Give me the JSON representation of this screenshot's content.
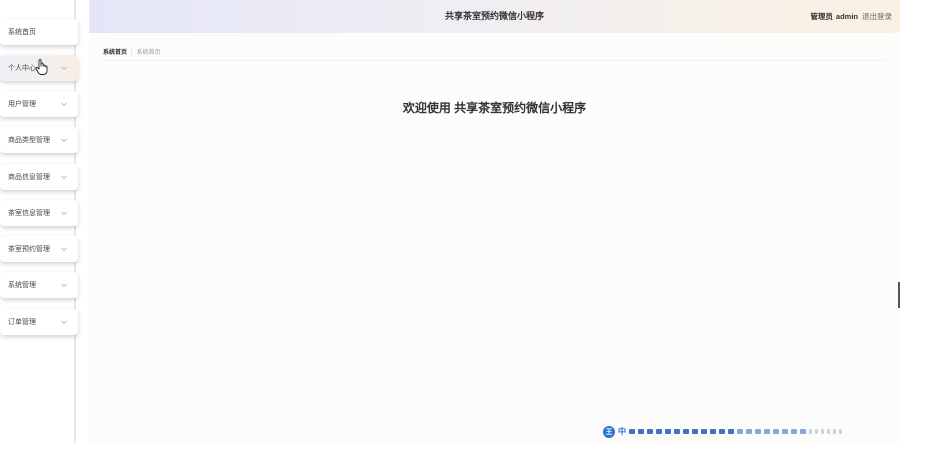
{
  "sidebar": {
    "items": [
      {
        "label": "系统首页",
        "has_chevron": false,
        "active": false
      },
      {
        "label": "个人中心",
        "has_chevron": true,
        "active": true
      },
      {
        "label": "用户管理",
        "has_chevron": true,
        "active": false
      },
      {
        "label": "商品类型管理",
        "has_chevron": true,
        "active": false
      },
      {
        "label": "商品信息管理",
        "has_chevron": true,
        "active": false
      },
      {
        "label": "茶室信息管理",
        "has_chevron": true,
        "active": false
      },
      {
        "label": "茶室预约管理",
        "has_chevron": true,
        "active": false
      },
      {
        "label": "系统管理",
        "has_chevron": true,
        "active": false
      },
      {
        "label": "订单管理",
        "has_chevron": true,
        "active": false
      }
    ]
  },
  "header": {
    "title": "共享茶室预约微信小程序",
    "role": "管理员",
    "username": "admin",
    "logout_label": "退出登录"
  },
  "breadcrumb": {
    "home": "系统首页",
    "current": "系统首页"
  },
  "main": {
    "welcome": "欢迎使用 共享茶室预约微信小程序"
  },
  "ime": {
    "logo": "王",
    "mode": "中"
  },
  "colors": {
    "header_gradient_start": "#e4e6f7",
    "header_gradient_end": "#f9f1e1",
    "active_item_bg": "#f0eef4",
    "ime_blue": "#2b6fd6"
  }
}
